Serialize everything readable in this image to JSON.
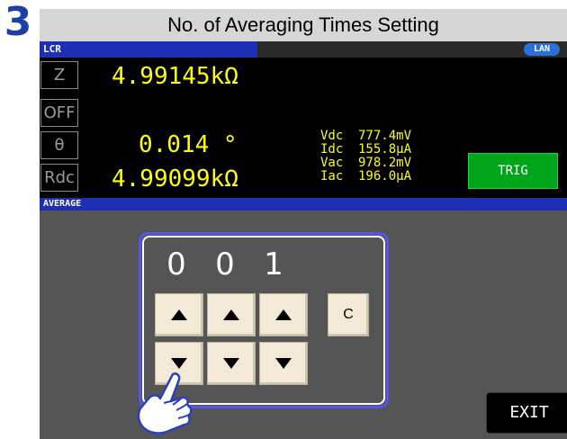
{
  "step": {
    "number": "3"
  },
  "title": {
    "text": "No. of Averaging Times Setting"
  },
  "topbar": {
    "tab_label": "LCR",
    "lan_label": "LAN"
  },
  "params": [
    {
      "label": "Z",
      "value": "4.99145kΩ"
    },
    {
      "label": "OFF",
      "value": ""
    },
    {
      "label": "θ",
      "value": "0.014 °"
    },
    {
      "label": "Rdc",
      "value": "4.99099kΩ"
    }
  ],
  "monitor": {
    "vdc": {
      "label": "Vdc",
      "value": "777.4mV"
    },
    "idc": {
      "label": "Idc",
      "value": "155.8µA"
    },
    "vac": {
      "label": "Vac",
      "value": "978.2mV"
    },
    "iac": {
      "label": "Iac",
      "value": "196.0µA"
    }
  },
  "trig": {
    "label": "TRIG"
  },
  "average": {
    "header_label": "AVERAGE",
    "digits": [
      "0",
      "0",
      "1"
    ],
    "clear_label": "C",
    "exit_label": "EXIT"
  },
  "colors": {
    "accent_blue": "#1d2fb3",
    "display_yellow": "#ffff00",
    "trig_green": "#00a51a",
    "frame_border": "#5555ee",
    "key_fill": "#f2ead6",
    "step_number": "#1d3fa8"
  },
  "icons": {
    "up": "triangle-up-icon",
    "down": "triangle-down-icon",
    "pointer": "pointing-hand-icon"
  }
}
